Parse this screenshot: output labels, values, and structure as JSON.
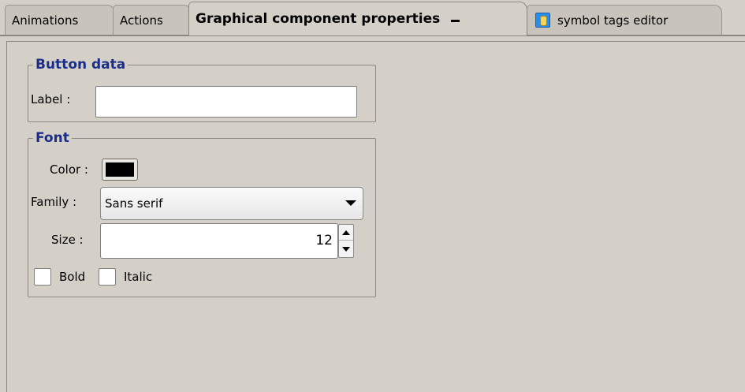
{
  "tabs": {
    "animations": "Animations",
    "actions": "Actions",
    "graphical": "Graphical component properties",
    "symbol_tags": "symbol tags editor"
  },
  "button_data": {
    "legend": "Button data",
    "label_caption": "Label :",
    "label_value": ""
  },
  "font": {
    "legend": "Font",
    "color_caption": "Color :",
    "color_value": "#000000",
    "family_caption": "Family :",
    "family_value": "Sans serif",
    "size_caption": "Size :",
    "size_value": "12",
    "bold_label": "Bold",
    "bold_checked": false,
    "italic_label": "Italic",
    "italic_checked": false
  },
  "icons": {
    "symbol_tags_tab": "database-icon",
    "minimize": "minimize-icon",
    "family_dropdown": "chevron-down-icon",
    "spinner_up": "arrow-up-icon",
    "spinner_down": "arrow-down-icon"
  },
  "colors": {
    "legend_text": "#1a2d8a",
    "panel_background": "#d4d0c8"
  }
}
